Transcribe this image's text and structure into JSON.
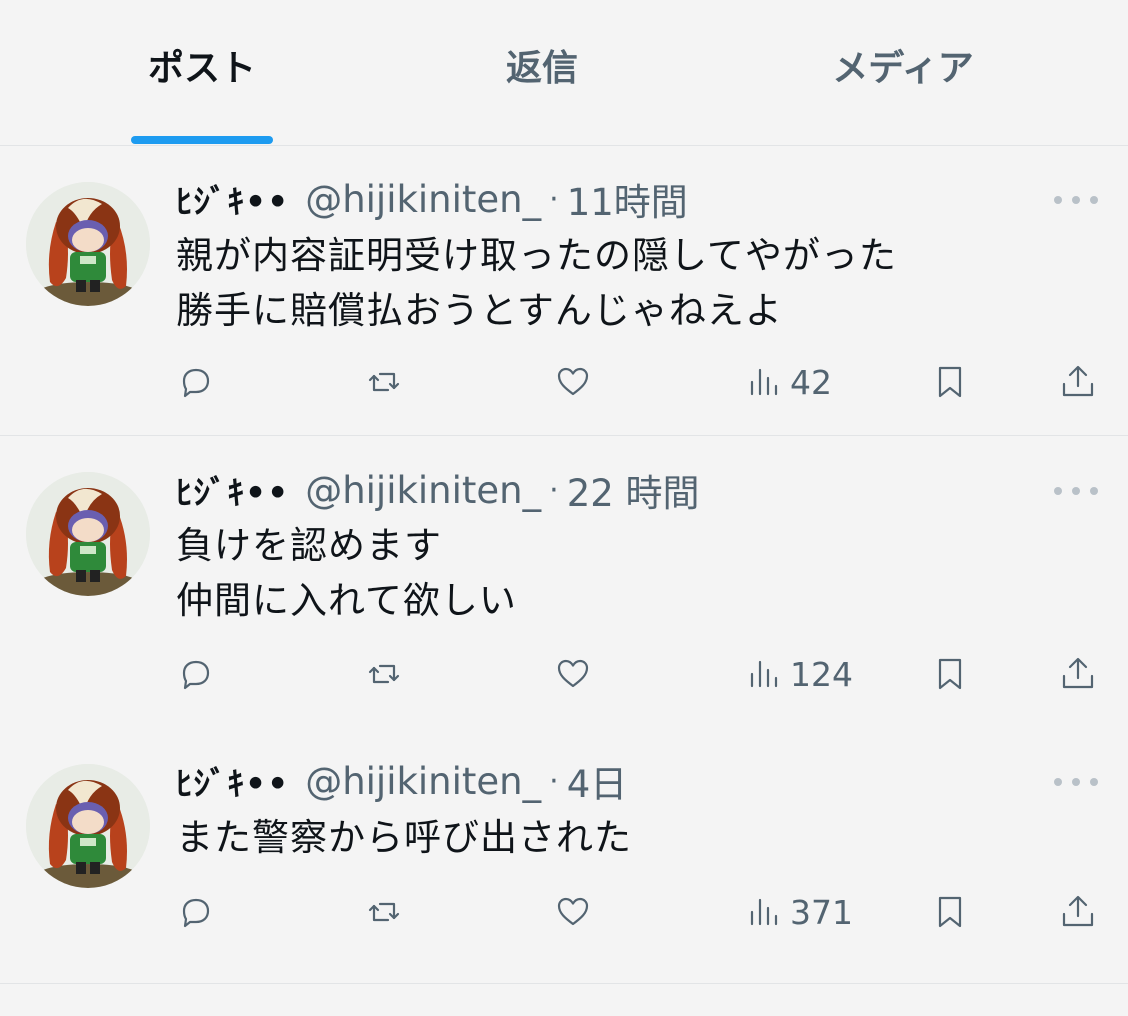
{
  "tabs": [
    {
      "label": "ポスト",
      "active": true
    },
    {
      "label": "返信",
      "active": false
    },
    {
      "label": "メディア",
      "active": false
    }
  ],
  "posts": [
    {
      "display_name": "ﾋｼﾞｷ••",
      "handle": "@hijikiniten_",
      "separator": "·",
      "time": "11時間",
      "text": "親が内容証明受け取ったの隠してやがった\n勝手に賠償払おうとすんじゃねえよ",
      "views": "42"
    },
    {
      "display_name": "ﾋｼﾞｷ••",
      "handle": "@hijikiniten_",
      "separator": "·",
      "time": "22 時間",
      "text": "負けを認めます\n仲間に入れて欲しい",
      "views": "124"
    },
    {
      "display_name": "ﾋｼﾞｷ••",
      "handle": "@hijikiniten_",
      "separator": "·",
      "time": "4日",
      "text": "また警察から呼び出された",
      "views": "371"
    }
  ],
  "icons": {
    "reply": "reply-icon",
    "repost": "repost-icon",
    "like": "like-icon",
    "views": "views-icon",
    "bookmark": "bookmark-icon",
    "share": "share-icon",
    "more": "more-icon"
  },
  "colors": {
    "accent": "#1d9bf0",
    "background": "#f4f4f4",
    "text_primary": "#0f1419",
    "text_secondary": "#536471"
  }
}
